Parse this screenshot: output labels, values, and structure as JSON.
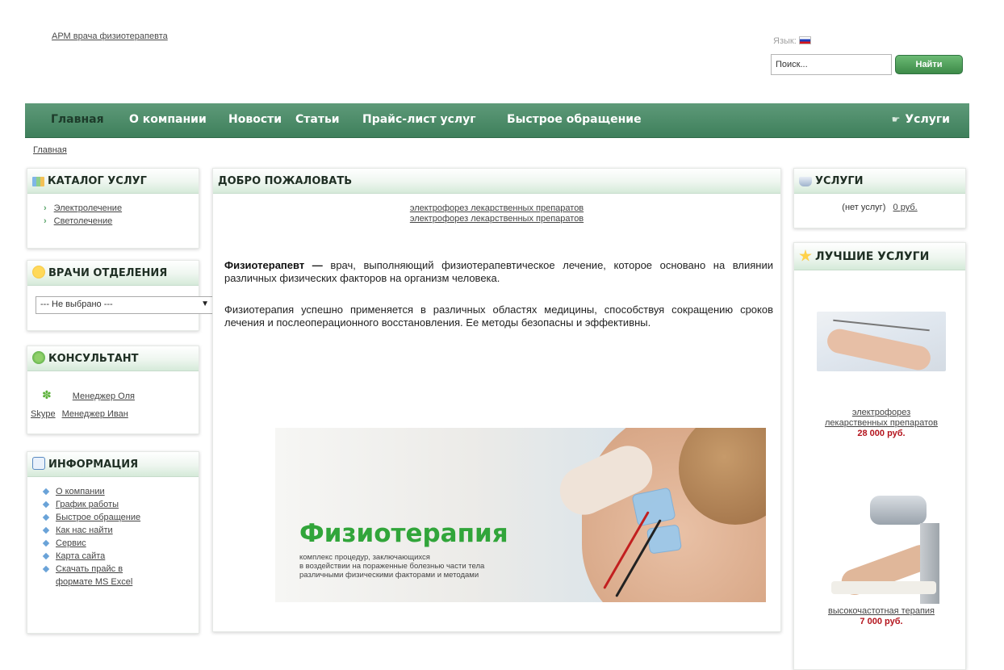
{
  "header": {
    "site_title": "АРМ врача физиотерапевта",
    "language_label": "Язык:",
    "search_placeholder": "Поиск...",
    "search_button": "Найти"
  },
  "nav": {
    "items": [
      "Главная",
      "О компании",
      "Новости",
      "Статьи",
      "Прайс-лист услуг",
      "Быстрое обращение"
    ],
    "services": "Услуги"
  },
  "breadcrumb": "Главная",
  "catalog": {
    "title": "КАТАЛОГ УСЛУГ",
    "items": [
      "Электролечение",
      "Светолечение"
    ]
  },
  "doctors": {
    "title": "ВРАЧИ ОТДЕЛЕНИЯ",
    "selected": "--- Не выбрано ---"
  },
  "consultant": {
    "title": "КОНСУЛЬТАНТ",
    "skype_label": "Skype",
    "managers": [
      "Менеджер Оля",
      "Менеджер Иван"
    ]
  },
  "info": {
    "title": "ИНФОРМАЦИЯ",
    "items": [
      "О компании",
      "График работы",
      "Быстрое обращение",
      "Как нас найти",
      "Сервис",
      "Карта сайта",
      "Скачать прайс в",
      "формате MS Excel"
    ]
  },
  "main": {
    "title": "ДОБРО ПОЖАЛОВАТЬ",
    "links": [
      "электрофорез лекарственных препаратов",
      "электрофорез лекарственных препаратов"
    ],
    "para1_bold": "Физиотерапевт —",
    "para1_rest": " врач, выполняющий физиотерапевтическое лечение, которое основано на влиянии различных физических факторов на организм человека.",
    "para2": "Физиотерапия успешно применяется в различных областях медицины, способствуя сокращению сроков лечения и послеоперационного восстановления. Ее методы безопасны и эффективны.",
    "banner_title": "Физиотерапия",
    "banner_sub": [
      "комплекс процедур, заключающихся",
      "в воздействии на пораженные болезнью части тела",
      "различными физическими факторами и методами"
    ]
  },
  "cart": {
    "title": "УСЛУГИ",
    "empty": "(нет услуг)",
    "total": "0 руб."
  },
  "best": {
    "title": "ЛУЧШИЕ УСЛУГИ",
    "items": [
      {
        "name_line1": "электрофорез",
        "name_line2": "лекарственных препаратов",
        "price": "28 000 руб."
      },
      {
        "name_line1": "высокочастотная терапия",
        "name_line2": "",
        "price": "7 000 руб."
      }
    ]
  },
  "colors": {
    "nav_green": "#4a8a66",
    "button_green": "#4f9d5a",
    "price_red": "#b4141d",
    "banner_green": "#31a53a"
  }
}
